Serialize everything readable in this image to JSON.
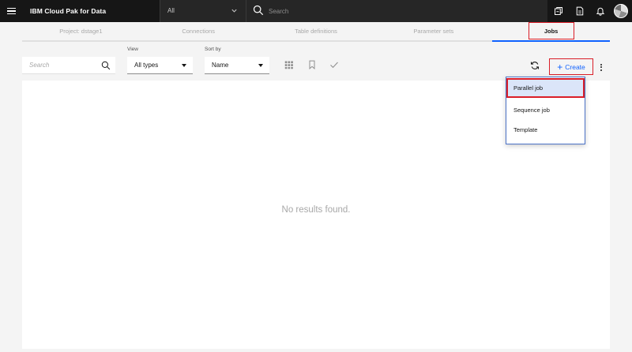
{
  "header": {
    "brand": "IBM Cloud Pak for Data",
    "scope_value": "All",
    "search_placeholder": "Search"
  },
  "tabs": [
    {
      "label": "Project: dstage1"
    },
    {
      "label": "Connections"
    },
    {
      "label": "Table definitions"
    },
    {
      "label": "Parameter sets"
    },
    {
      "label": "Jobs",
      "active": true
    }
  ],
  "toolbar": {
    "search_placeholder": "Search",
    "view_label": "View",
    "view_value": "All types",
    "sort_label": "Sort by",
    "sort_value": "Name",
    "create_label": "Create"
  },
  "content": {
    "empty_message": "No results found."
  },
  "create_menu": {
    "items": [
      "Parallel job",
      "Sequence job",
      "Template"
    ]
  },
  "colors": {
    "header_bg": "#161616",
    "accent": "#0f62fe",
    "highlight": "#da1e28"
  }
}
